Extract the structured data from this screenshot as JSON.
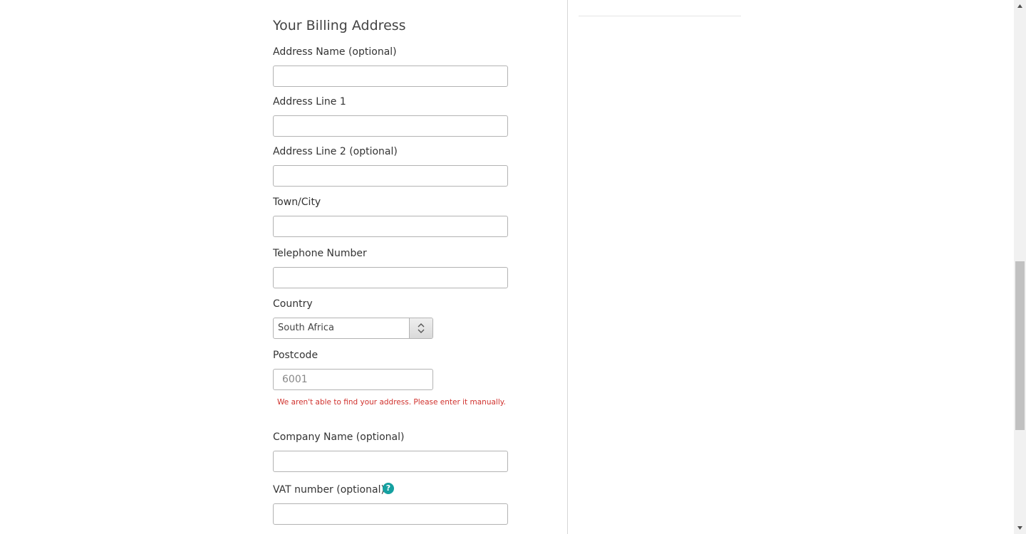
{
  "billing": {
    "title": "Your Billing Address",
    "address_name": {
      "label": "Address Name (optional)",
      "value": ""
    },
    "address_line1": {
      "label": "Address Line 1",
      "value": ""
    },
    "address_line2": {
      "label": "Address Line 2 (optional)",
      "value": ""
    },
    "town_city": {
      "label": "Town/City",
      "value": ""
    },
    "telephone": {
      "label": "Telephone Number",
      "value": ""
    },
    "country": {
      "label": "Country",
      "selected": "South Africa"
    },
    "postcode": {
      "label": "Postcode",
      "placeholder": "6001",
      "value": ""
    },
    "error_message": "We aren't able to find your address. Please enter it manually.",
    "company_name": {
      "label": "Company Name (optional)",
      "value": ""
    },
    "vat_number": {
      "label": "VAT number (optional)",
      "value": "",
      "help_icon": "?"
    }
  },
  "colors": {
    "error": "#d0312d",
    "help_icon": "#14a0a0",
    "input_border": "#b3b3b3"
  },
  "icons": {
    "select_arrows": "chevron-up-down-icon",
    "help": "question-circle-icon",
    "scroll_up": "triangle-up-icon",
    "scroll_down": "triangle-down-icon"
  }
}
